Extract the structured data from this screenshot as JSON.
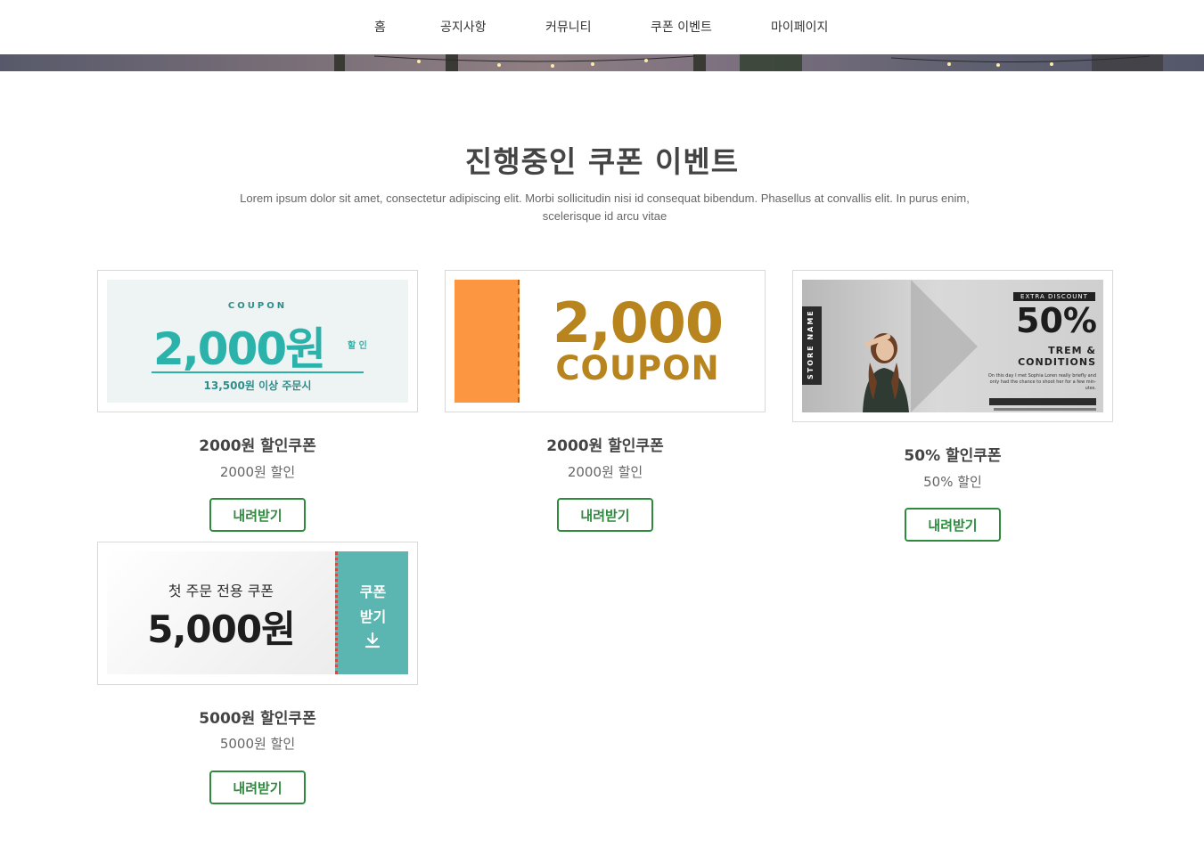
{
  "nav": {
    "items": [
      {
        "label": "홈"
      },
      {
        "label": "공지사항"
      },
      {
        "label": "커뮤니티"
      },
      {
        "label": "쿠폰 이벤트"
      },
      {
        "label": "마이페이지"
      }
    ]
  },
  "section": {
    "title": "진행중인 쿠폰 이벤트",
    "description": "Lorem ipsum dolor sit amet, consectetur adipiscing elit. Morbi sollicitudin nisi id consequat bibendum. Phasellus at convallis elit. In purus enim, scelerisque id arcu vitae"
  },
  "coupons": [
    {
      "name": "2000원 할인쿠폰",
      "subtitle": "2000원 할인",
      "button_label": "내려받기",
      "image": {
        "top_label": "COUPON",
        "amount": "2,000원",
        "amount_suffix": "할 인",
        "condition": "13,500원 이상 주문시"
      }
    },
    {
      "name": "2000원 할인쿠폰",
      "subtitle": "2000원 할인",
      "button_label": "내려받기",
      "image": {
        "amount": "2,000",
        "word": "COUPON",
        "stub_color": "#fd9640",
        "text_color": "#b8841e"
      }
    },
    {
      "name": "50% 할인쿠폰",
      "subtitle": "50% 할인",
      "button_label": "내려받기",
      "image": {
        "side_label": "STORE NAME",
        "tag": "EXTRA DISCOUNT",
        "percent": "50%",
        "terms_line1": "TREM &",
        "terms_line2": "CONDITIONS",
        "fine_print": "On this day I met Sophia Loren really briefly and only had the chance to shoot her for a few min-utes."
      }
    },
    {
      "name": "5000원 할인쿠폰",
      "subtitle": "5000원 할인",
      "button_label": "내려받기",
      "image": {
        "headline": "첫 주문 전용 쿠폰",
        "amount": "5,000원",
        "tab_line1": "쿠폰",
        "tab_line2": "받기",
        "tab_color": "#5bb5b0",
        "icon": "download-icon"
      }
    }
  ],
  "colors": {
    "button_accent": "#2e8b3e",
    "coupon1_teal": "#2bb3ab"
  }
}
